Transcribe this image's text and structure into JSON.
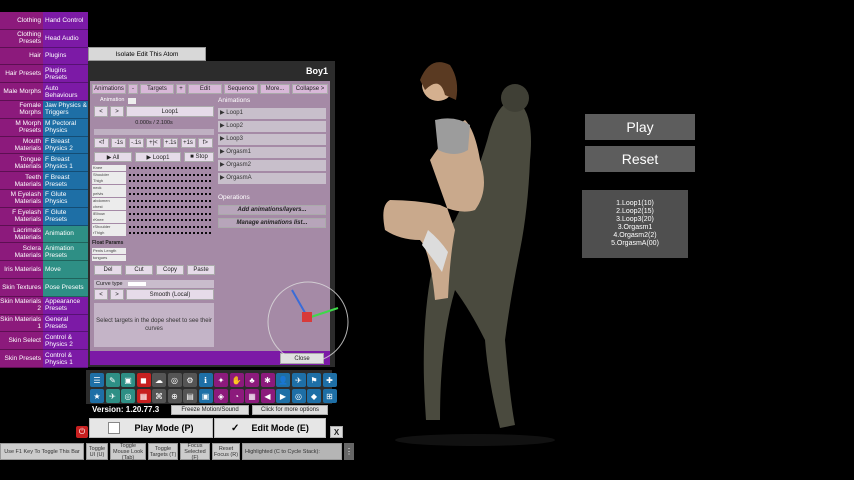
{
  "sidebar": {
    "rows": [
      {
        "left": "Clothing",
        "right": "Hand Control",
        "color": "#7c1aa6"
      },
      {
        "left": "Clothing Presets",
        "right": "Head Audio",
        "color": "#7c1aa6"
      },
      {
        "left": "Hair",
        "right": "Plugins",
        "color": "#7c1aa6"
      },
      {
        "left": "Hair Presets",
        "right": "Plugins Presets",
        "color": "#7c1aa6"
      },
      {
        "left": "Male Morphs",
        "right": "Auto Behaviours",
        "color": "#7c1aa6"
      },
      {
        "left": "Female Morphs",
        "right": "Jaw Physics & Triggers",
        "color": "#1e6fa6"
      },
      {
        "left": "M Morph Presets",
        "right": "M Pectoral Physics",
        "color": "#1e6fa6"
      },
      {
        "left": "Mouth Materials",
        "right": "F Breast Physics 2",
        "color": "#1e6fa6"
      },
      {
        "left": "Tongue Materials",
        "right": "F Breast Physics 1",
        "color": "#1e6fa6"
      },
      {
        "left": "Teeth Materials",
        "right": "F Breast Presets",
        "color": "#1e6fa6"
      },
      {
        "left": "M Eyelash Materials",
        "right": "F Glute Physics",
        "color": "#1e6fa6"
      },
      {
        "left": "F Eyelash Materials",
        "right": "F Glute Presets",
        "color": "#1e6fa6"
      },
      {
        "left": "Lacrimals Materials",
        "right": "Animation",
        "color": "#2e8f85"
      },
      {
        "left": "Sclera Materials",
        "right": "Animation Presets",
        "color": "#2e8f85"
      },
      {
        "left": "Iris Materials",
        "right": "Move",
        "color": "#2e8f85"
      },
      {
        "left": "Skin Textures",
        "right": "Pose Presets",
        "color": "#2e8f85"
      },
      {
        "left": "Skin Materials 2",
        "right": "Appearance Presets",
        "color": "#7c1aa6"
      },
      {
        "left": "Skin Materials 1",
        "right": "General Presets",
        "color": "#7c1aa6"
      },
      {
        "left": "Skin Select",
        "right": "Control & Physics 2",
        "color": "#7c1aa6"
      },
      {
        "left": "Skin Presets",
        "right": "Control & Physics 1",
        "color": "#7c1aa6"
      }
    ]
  },
  "panel": {
    "isolate_label": "Isolate Edit This Atom",
    "title": "Boy1",
    "tabs": {
      "animations": "Animations",
      "minus": "-",
      "targets": "Targets",
      "plus": "+",
      "edit": "Edit",
      "sequence": "Sequence",
      "more": "More...",
      "collapse": "Collapse >"
    },
    "animation_label": "Animation",
    "prev": "<",
    "next": ">",
    "current_anim": "Loop1",
    "time_display": "0.000s / 2.100s",
    "step_buttons": [
      "<f",
      "-1s",
      "-.1s",
      "+|<",
      "+.1s",
      "+1s",
      "f>"
    ],
    "play_all": "▶ All",
    "play_loop": "▶ Loop1",
    "stop": "■ Stop",
    "tracks": [
      "Knee",
      "Shoulder",
      "Thigh",
      "neck",
      "pelvis",
      "abdomen",
      "chest",
      "lElbow",
      "rKnee",
      "rShoulder",
      "rThigh"
    ],
    "float_params": "Float Params",
    "float_items": [
      "Penis Length",
      "tongues"
    ],
    "del": "Del",
    "cut": "Cut",
    "copy": "Copy",
    "paste": "Paste",
    "curve_type": "Curve type",
    "curve_value": "Smooth (Local)",
    "select_msg": "Select targets in the dope sheet to see their curves",
    "animations_header": "Animations",
    "anim_list": [
      "Loop1",
      "Loop2",
      "Loop3",
      "Orgasm1",
      "Orgasm2",
      "OrgasmA"
    ],
    "operations": "Operations",
    "add_anim": "Add animations/layers...",
    "manage_anim": "Manage animations list...",
    "close": "Close"
  },
  "toolbar": {
    "version": "Version: 1.20.77.3",
    "freeze": "Freeze Motion/Sound",
    "more_options": "Click for more options",
    "play_mode": "Play Mode (P)",
    "edit_mode": "Edit Mode (E)",
    "x": "X",
    "check": "✓"
  },
  "bottom": {
    "hint": "Use F1 Key To Toggle This Bar",
    "toggle_ui": "Toggle UI (U)",
    "toggle_mouse": "Toggle Mouse Look (Tab)",
    "toggle_targets": "Toggle Targets (T)",
    "focus": "Focus Selected (F)",
    "reset_focus": "Reset Focus (R)",
    "highlighted": "Highlighted (C to Cycle Stack):"
  },
  "overlay": {
    "play": "Play",
    "reset": "Reset",
    "sequence": [
      "1.Loop1(10)",
      "2.Loop2(15)",
      "3.Loop3(20)",
      "3.Orgasm1",
      "4.Orgasm2(2)",
      "5.OrgasmA(00)"
    ]
  },
  "colors": {
    "sidebar_left": "#8c1a7c",
    "panel_bg": "#a58aa6",
    "accent_purple": "#7c1aa6",
    "accent_blue": "#1e6fa6",
    "accent_teal": "#2e8f85"
  }
}
